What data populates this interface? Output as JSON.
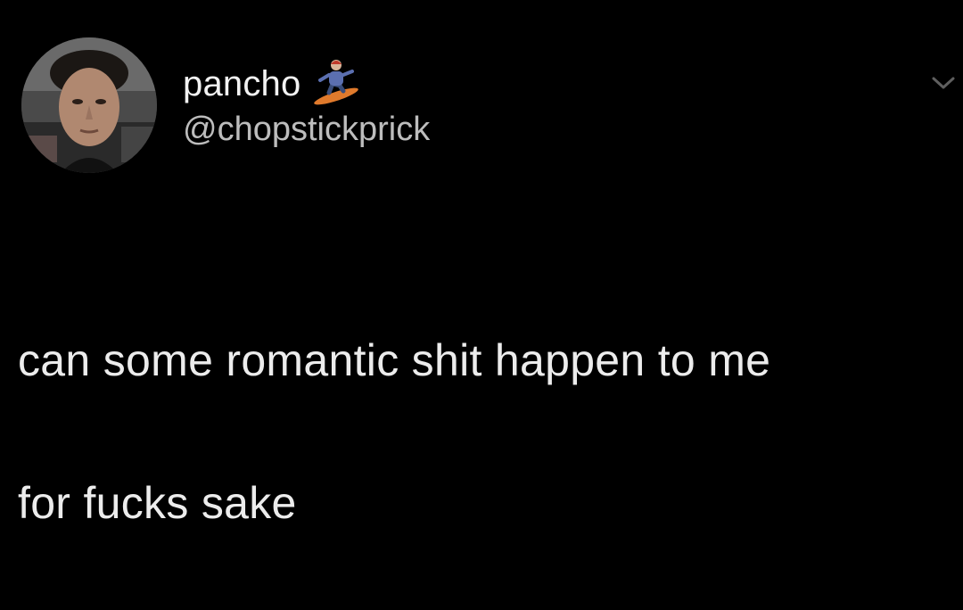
{
  "tweet": {
    "author": {
      "display_name": "pancho",
      "display_name_emoji": "snowboarder-icon",
      "handle": "@chopstickprick",
      "avatar": "avatar-photo"
    },
    "body_lines": [
      "can some romantic shit happen to me",
      "for fucks sake"
    ],
    "menu_icon": "chevron-down-icon"
  },
  "colors": {
    "background": "#000000",
    "text_primary": "#ececec",
    "text_secondary": "#bdbdbd"
  }
}
